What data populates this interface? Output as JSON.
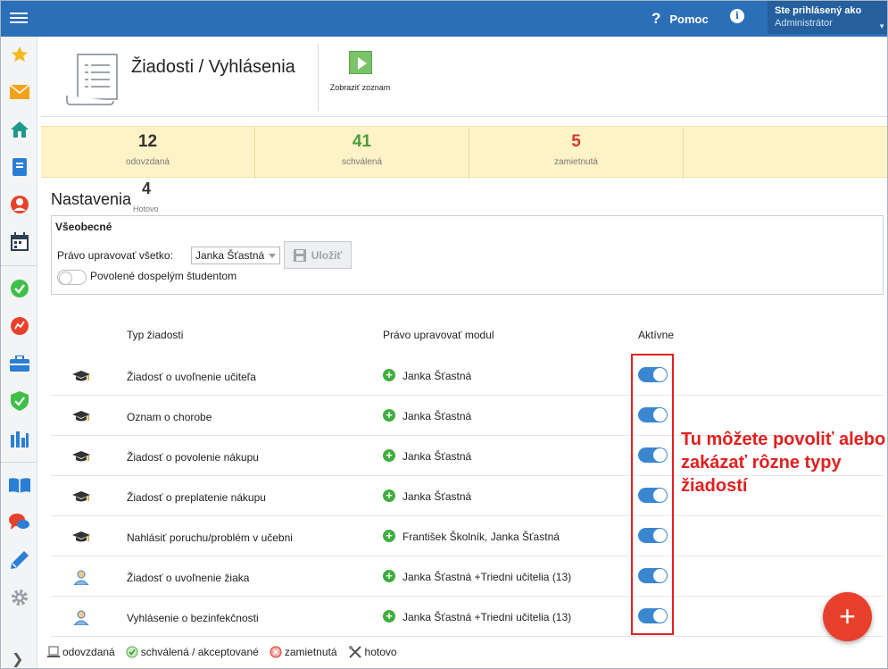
{
  "topbar": {
    "help_label": "Pomoc",
    "user_line1": "Ste prihlásený ako",
    "user_line2": "Administrátor"
  },
  "sidebar": {
    "icons": [
      "star-icon",
      "mail-icon",
      "home-icon",
      "notebook-icon",
      "person-icon",
      "calendar-icon",
      "check-circle-icon",
      "chart-pie-icon",
      "briefcase-icon",
      "shield-check-icon",
      "bar-chart-icon",
      "book-icon",
      "chat-icon",
      "pen-icon",
      "gear-icon",
      "chevron-right-icon"
    ]
  },
  "header": {
    "title": "Žiadosti / Vyhlásenia",
    "show_list_label": "Zobraziť zoznam"
  },
  "stats": [
    {
      "value": "12",
      "label": "odovzdaná",
      "color": "#333333"
    },
    {
      "value": "41",
      "label": "schválená",
      "color": "#4e9a3a"
    },
    {
      "value": "5",
      "label": "zamietnutá",
      "color": "#d43a2a"
    }
  ],
  "settings": {
    "heading": "Nastavenia",
    "done_value": "4",
    "done_label": "Hotovo",
    "panel_title": "Všeobecné",
    "edit_all_label": "Právo upravovať všetko:",
    "edit_all_value": "Janka Šťastná",
    "save_label": "Uložiť",
    "adult_students_label": "Povolené dospelým študentom"
  },
  "table": {
    "col_type": "Typ žiadosti",
    "col_module": "Právo upravovať modul",
    "col_active": "Aktívne",
    "rows": [
      {
        "icon": "graduation-cap-icon",
        "name": "Žiadosť o uvoľnenie učiteľa",
        "editors": "Janka Šťastná",
        "active": true
      },
      {
        "icon": "graduation-cap-icon",
        "name": "Oznam o chorobe",
        "editors": "Janka Šťastná",
        "active": true
      },
      {
        "icon": "graduation-cap-icon",
        "name": "Žiadosť o povolenie nákupu",
        "editors": "Janka Šťastná",
        "active": true
      },
      {
        "icon": "graduation-cap-icon",
        "name": "Žiadosť o preplatenie nákupu",
        "editors": "Janka Šťastná",
        "active": true
      },
      {
        "icon": "graduation-cap-icon",
        "name": "Nahlásiť poruchu/problém v učebni",
        "editors": "František Školník, Janka Šťastná",
        "active": true
      },
      {
        "icon": "student-icon",
        "name": "Žiadosť o uvoľnenie žiaka",
        "editors": "Janka Šťastná +Triedni učitelia (13)",
        "active": true
      },
      {
        "icon": "student-icon",
        "name": "Vyhlásenie o bezinfekčnosti",
        "editors": "Janka Šťastná +Triedni učitelia (13)",
        "active": true
      }
    ]
  },
  "annotation": "Tu môžete povoliť alebo zakázať rôzne typy žiadostí",
  "legend": {
    "submitted": "odovzdaná",
    "approved": "schválená / akceptované",
    "rejected": "zamietnutá",
    "done": "hotovo"
  },
  "colors": {
    "topbar": "#2b6fb8",
    "toggle_on": "#3a87d0",
    "annotation": "#e02020",
    "fab": "#e8412b",
    "stats_bg": "#fdf3c7"
  }
}
